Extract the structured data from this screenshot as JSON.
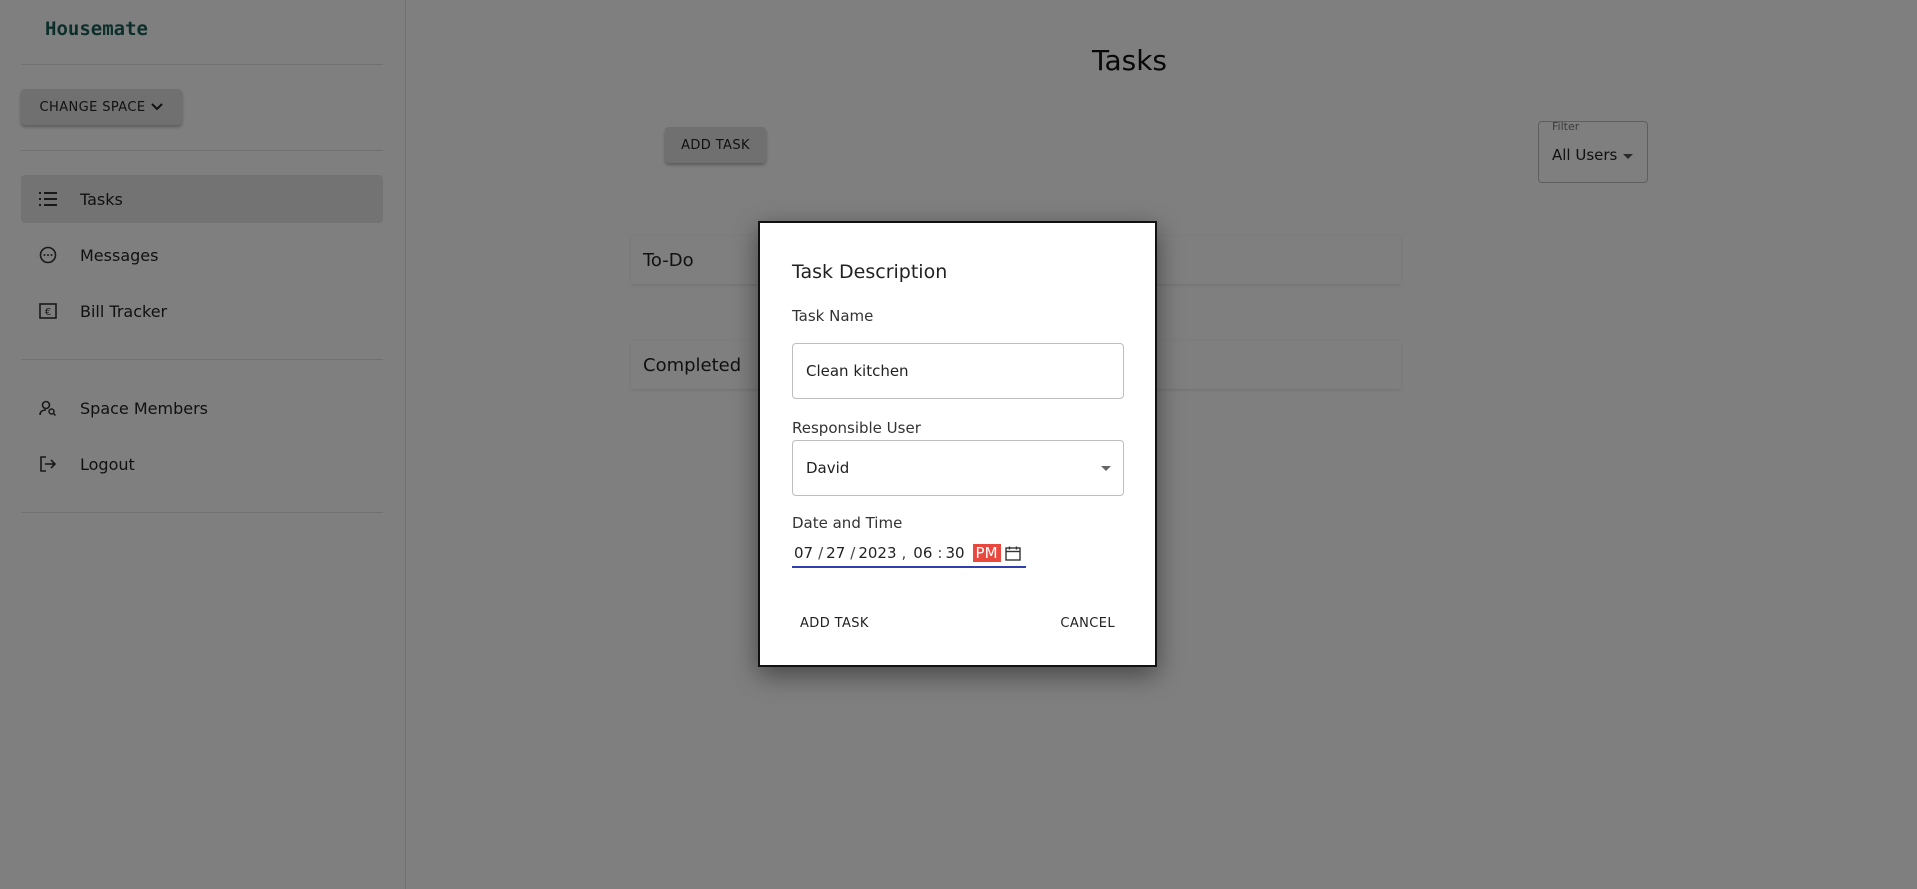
{
  "sidebar": {
    "brand": "Housemate",
    "change_space_label": "CHANGE SPACE",
    "items": [
      {
        "label": "Tasks",
        "icon": "list-icon",
        "active": true
      },
      {
        "label": "Messages",
        "icon": "chat-bubble-icon",
        "active": false
      },
      {
        "label": "Bill Tracker",
        "icon": "euro-receipt-icon",
        "active": false
      },
      {
        "label": "Space Members",
        "icon": "person-search-icon",
        "active": false
      },
      {
        "label": "Logout",
        "icon": "logout-icon",
        "active": false
      }
    ]
  },
  "main": {
    "title": "Tasks",
    "add_task_label": "ADD TASK",
    "filter": {
      "legend": "Filter",
      "value": "All Users"
    },
    "sections": [
      "To-Do",
      "Completed"
    ]
  },
  "dialog": {
    "title": "Task Description",
    "task_name_label": "Task Name",
    "task_name_value": "Clean kitchen",
    "responsible_user_label": "Responsible User",
    "responsible_user_value": "David",
    "date_time_label": "Date and Time",
    "date_time": {
      "month": "07",
      "day": "27",
      "year": "2023",
      "hour": "06",
      "minute": "30",
      "ampm": "PM"
    },
    "add_task_label": "ADD TASK",
    "cancel_label": "CANCEL"
  },
  "colors": {
    "brand": "#1b5e57",
    "overlay": "rgba(0,0,0,0.5)",
    "date_underline": "#2f3fae",
    "ampm_highlight": "#e8483e"
  }
}
